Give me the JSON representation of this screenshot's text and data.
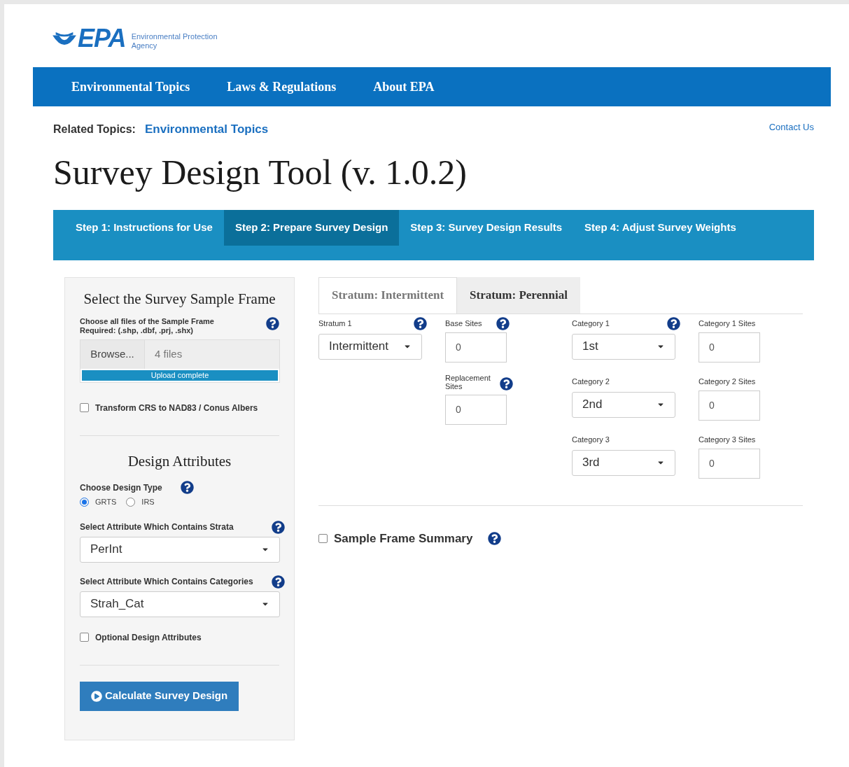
{
  "header": {
    "logo_text": "EPA",
    "agency": "Environmental Protection Agency"
  },
  "nav": [
    {
      "label": "Environmental Topics"
    },
    {
      "label": "Laws & Regulations"
    },
    {
      "label": "About EPA"
    }
  ],
  "related": {
    "label": "Related Topics:",
    "link": "Environmental Topics"
  },
  "contact": "Contact Us",
  "title": "Survey Design Tool (v. 1.0.2)",
  "steps": [
    {
      "label": "Step 1: Instructions for Use",
      "selected": false
    },
    {
      "label": "Step 2: Prepare Survey Design",
      "selected": true
    },
    {
      "label": "Step 3: Survey Design Results",
      "selected": false
    },
    {
      "label": "Step 4: Adjust Survey Weights",
      "selected": false
    }
  ],
  "sidebar": {
    "heading": "Select the Survey Sample Frame",
    "file_label": [
      "Choose all files of the Sample Frame",
      "Required: (.shp, .dbf, .prj, .shx)"
    ],
    "browse": "Browse...",
    "file_value": "4 files",
    "progress": {
      "label": "Upload complete",
      "level": 1
    },
    "transform": {
      "label": "Transform CRS to NAD83 / Conus Albers",
      "checked": false
    },
    "design_heading": "Design Attributes",
    "design_type": {
      "label": "Choose Design Type",
      "options": [
        {
          "label": "GRTS",
          "selected": true
        },
        {
          "label": "IRS",
          "selected": false
        }
      ]
    },
    "strata": {
      "label": "Select Attribute Which Contains Strata",
      "value": "PerInt"
    },
    "categories": {
      "label": "Select Attribute Which Contains Categories",
      "value": "Strah_Cat"
    },
    "optional": {
      "label": "Optional Design Attributes",
      "checked": false
    },
    "calculate": "Calculate Survey Design"
  },
  "stratum_tabs": [
    {
      "label": "Stratum: Intermittent",
      "selected": true
    },
    {
      "label": "Stratum: Perennial",
      "selected": false
    }
  ],
  "fields": {
    "stratum": {
      "label": "Stratum 1",
      "value": "Intermittent"
    },
    "base_sites": {
      "label": "Base Sites",
      "value": "0"
    },
    "replacement_sites": {
      "label": "Replacement Sites",
      "value": "0"
    },
    "categories": [
      {
        "label": "Category 1",
        "value": "1st",
        "help": true,
        "sites_label": "Category 1 Sites",
        "sites_value": "0"
      },
      {
        "label": "Category 2",
        "value": "2nd",
        "help": false,
        "sites_label": "Category 2 Sites",
        "sites_value": "0"
      },
      {
        "label": "Category 3",
        "value": "3rd",
        "help": false,
        "sites_label": "Category 3 Sites",
        "sites_value": "0"
      }
    ]
  },
  "summary": {
    "label": "Sample Frame Summary",
    "checked": false
  }
}
